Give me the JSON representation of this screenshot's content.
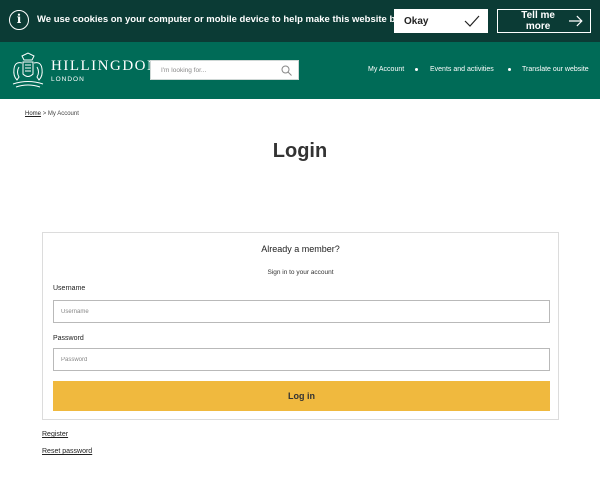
{
  "cookie_banner": {
    "text": "We use cookies on your computer or mobile device to help make this website better.",
    "okay_label": "Okay",
    "tell_more_label": "Tell me more",
    "info_icon_glyph": "i"
  },
  "header": {
    "logo_main": "HILLINGDON",
    "logo_sub": "LONDON",
    "search_placeholder": "I'm looking for...",
    "nav": [
      "My Account",
      "Events and activities",
      "Translate our website"
    ]
  },
  "breadcrumb": {
    "home": "Home",
    "separator": ">",
    "current": "My Account"
  },
  "page_title": "Login",
  "login_panel": {
    "heading": "Already a member?",
    "subheading": "Sign in to your account",
    "username_label": "Username",
    "username_placeholder": "Username",
    "password_label": "Password",
    "password_placeholder": "Password",
    "submit_label": "Log in"
  },
  "links": {
    "register": "Register",
    "reset_password": "Reset password"
  },
  "colors": {
    "cookie_bar": "#0b3b35",
    "header": "#006b57",
    "button_yellow": "#f0b93e"
  }
}
